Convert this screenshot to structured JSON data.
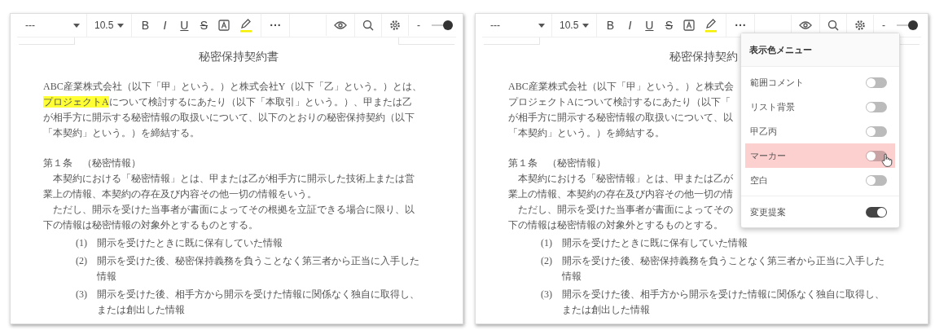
{
  "panels": [
    {
      "toolbar": {
        "style": "---",
        "size": "10.5",
        "format": [
          "B",
          "I",
          "U",
          "S"
        ],
        "more": "···",
        "zoom": {
          "label": "-",
          "level": 1
        }
      },
      "document": {
        "title": "秘密保持契約書",
        "blocks": [
          {
            "kind": "para",
            "lines": [
              [
                {
                  "text": "ABC産業株式会社（以下「甲」という。）と株式会社Y（以下「乙」という。）とは、",
                  "marked": false
                }
              ],
              [
                {
                  "text": "プロジェクトA",
                  "marked": true
                },
                {
                  "text": "について検討するにあたり（以下「本取引」という。）、甲または乙",
                  "marked": false
                }
              ],
              [
                {
                  "text": "が相手方に開示する秘密情報の取扱いについて、以下のとおりの秘密保持契約（以下",
                  "marked": false
                }
              ],
              [
                {
                  "text": "「本契約」という。）を締結する。",
                  "marked": false
                }
              ]
            ]
          },
          {
            "kind": "heading",
            "lines": [
              "第１条　（秘密情報）"
            ]
          },
          {
            "kind": "body",
            "lines": [
              "本契約における「秘密情報」とは、甲または乙が相手方に開示した技術上または営",
              "業上の情報、本契約の存在及び内容その他一切の情報をいう。"
            ]
          },
          {
            "kind": "body",
            "lines": [
              "ただし、開示を受けた当事者が書面によってその根拠を立証できる場合に限り、以",
              "下の情報は秘密情報の対象外とするものとする。"
            ]
          },
          {
            "kind": "item",
            "number": "(1)",
            "lines": [
              "開示を受けたときに既に保有していた情報"
            ]
          },
          {
            "kind": "item",
            "number": "(2)",
            "lines": [
              "開示を受けた後、秘密保持義務を負うことなく第三者から正当に入手した",
              "情報"
            ]
          },
          {
            "kind": "item",
            "number": "(3)",
            "lines": [
              "開示を受けた後、相手方から開示を受けた情報に関係なく独自に取得し、",
              "または創出した情報"
            ]
          }
        ]
      }
    },
    {
      "toolbar": {
        "style": "---",
        "size": "10.5",
        "format": [
          "B",
          "I",
          "U",
          "S"
        ],
        "more": "···",
        "zoom": {
          "label": "-",
          "level": 1
        }
      },
      "document": {
        "title": "秘密保持契約",
        "blocks": [
          {
            "kind": "para",
            "lines": [
              [
                {
                  "text": "ABC産業株式会社（以下「甲」という。）と株式会",
                  "marked": false
                }
              ],
              [
                {
                  "text": "プロジェクトA",
                  "marked": false
                },
                {
                  "text": "について検討するにあたり（以下「",
                  "marked": false
                }
              ],
              [
                {
                  "text": "が相手方に開示する秘密情報の取扱いについて、以",
                  "marked": false
                }
              ],
              [
                {
                  "text": "「本契約」という。）を締結する。",
                  "marked": false
                }
              ]
            ]
          },
          {
            "kind": "heading",
            "lines": [
              "第１条　（秘密情報）"
            ]
          },
          {
            "kind": "body",
            "lines": [
              "本契約における「秘密情報」とは、甲または乙が",
              "業上の情報、本契約の存在及び内容その他一切の情"
            ]
          },
          {
            "kind": "body",
            "lines": [
              "ただし、開示を受けた当事者が書面によってその",
              "下の情報は秘密情報の対象外とするものとする。"
            ]
          },
          {
            "kind": "item",
            "number": "(1)",
            "lines": [
              "開示を受けたときに既に保有していた情報"
            ]
          },
          {
            "kind": "item",
            "number": "(2)",
            "lines": [
              "開示を受けた後、秘密保持義務を負うことなく第三者から正当に入手した",
              "情報"
            ]
          },
          {
            "kind": "item",
            "number": "(3)",
            "lines": [
              "開示を受けた後、相手方から開示を受けた情報に関係なく独自に取得し、",
              "または創出した情報"
            ]
          }
        ]
      },
      "menu": {
        "title": "表示色メニュー",
        "groups": [
          [
            {
              "label": "範囲コメント",
              "on": false,
              "hovered": false
            },
            {
              "label": "リスト背景",
              "on": false,
              "hovered": false
            },
            {
              "label": "甲乙丙",
              "on": false,
              "hovered": false
            },
            {
              "label": "マーカー",
              "on": false,
              "hovered": true
            },
            {
              "label": "空白",
              "on": false,
              "hovered": false
            }
          ],
          [
            {
              "label": "変更提案",
              "on": true,
              "hovered": false
            }
          ]
        ]
      }
    }
  ]
}
